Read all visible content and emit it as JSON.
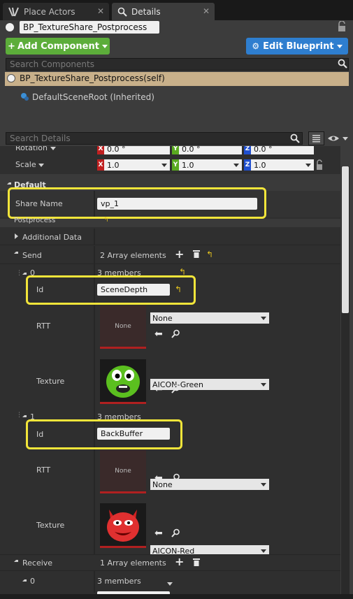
{
  "tabs": [
    {
      "label": "Place Actors"
    },
    {
      "label": "Details"
    }
  ],
  "actor_name": "BP_TextureShare_Postprocess",
  "buttons": {
    "add_component": "Add Component",
    "edit_blueprint": "Edit Blueprint"
  },
  "components": {
    "search_placeholder": "Search Components",
    "self_item": "BP_TextureShare_Postprocess(self)",
    "root_item": "DefaultSceneRoot (Inherited)"
  },
  "details": {
    "search_placeholder": "Search Details"
  },
  "transform": {
    "rotation_label": "Rotation",
    "rotation": {
      "x": "0.0 °",
      "y": "0.0 °",
      "z": "0.0 °"
    },
    "scale_label": "Scale",
    "scale": {
      "x": "1.0",
      "y": "1.0",
      "z": "1.0"
    },
    "axis": {
      "x": "X",
      "y": "Y",
      "z": "Z"
    }
  },
  "default": {
    "section": "Default",
    "share_name_label": "Share Name",
    "share_name_value": "vp_1"
  },
  "postprocess": {
    "section": "Postprocess",
    "additional_data": "Additional Data",
    "send_label": "Send",
    "send_count": "2 Array elements",
    "elements": [
      {
        "index": "0",
        "members": "3 members",
        "id_label": "Id",
        "id_value": "SceneDepth",
        "rtt_label": "RTT",
        "rtt_thumb": "None",
        "rtt_value": "None",
        "texture_label": "Texture",
        "texture_value": "AICON-Green"
      },
      {
        "index": "1",
        "members": "3 members",
        "id_label": "Id",
        "id_value": "BackBuffer",
        "rtt_label": "RTT",
        "rtt_thumb": "None",
        "rtt_value": "None",
        "texture_label": "Texture",
        "texture_value": "AICON-Red"
      }
    ],
    "receive_label": "Receive",
    "receive_count": "1 Array elements",
    "receive_elements": [
      {
        "index": "0",
        "members": "3 members"
      }
    ]
  },
  "colors": {
    "add_component": "#5cad3a",
    "edit_blueprint": "#2e7ecf",
    "highlight": "#f2e53a",
    "axis_x": "#c02020",
    "axis_y": "#5aaa20",
    "axis_z": "#2050d0",
    "component_selected": "#c8b08a"
  },
  "icons": [
    "actors-icon",
    "details-icon",
    "close-icon",
    "lock-icon",
    "search-icon",
    "gear-icon",
    "view-options-icon",
    "grid-view-icon",
    "plus-icon",
    "trash-icon",
    "reset-arrow-icon",
    "use-selected-icon",
    "browse-icon",
    "green-alien-icon",
    "red-devil-icon"
  ]
}
